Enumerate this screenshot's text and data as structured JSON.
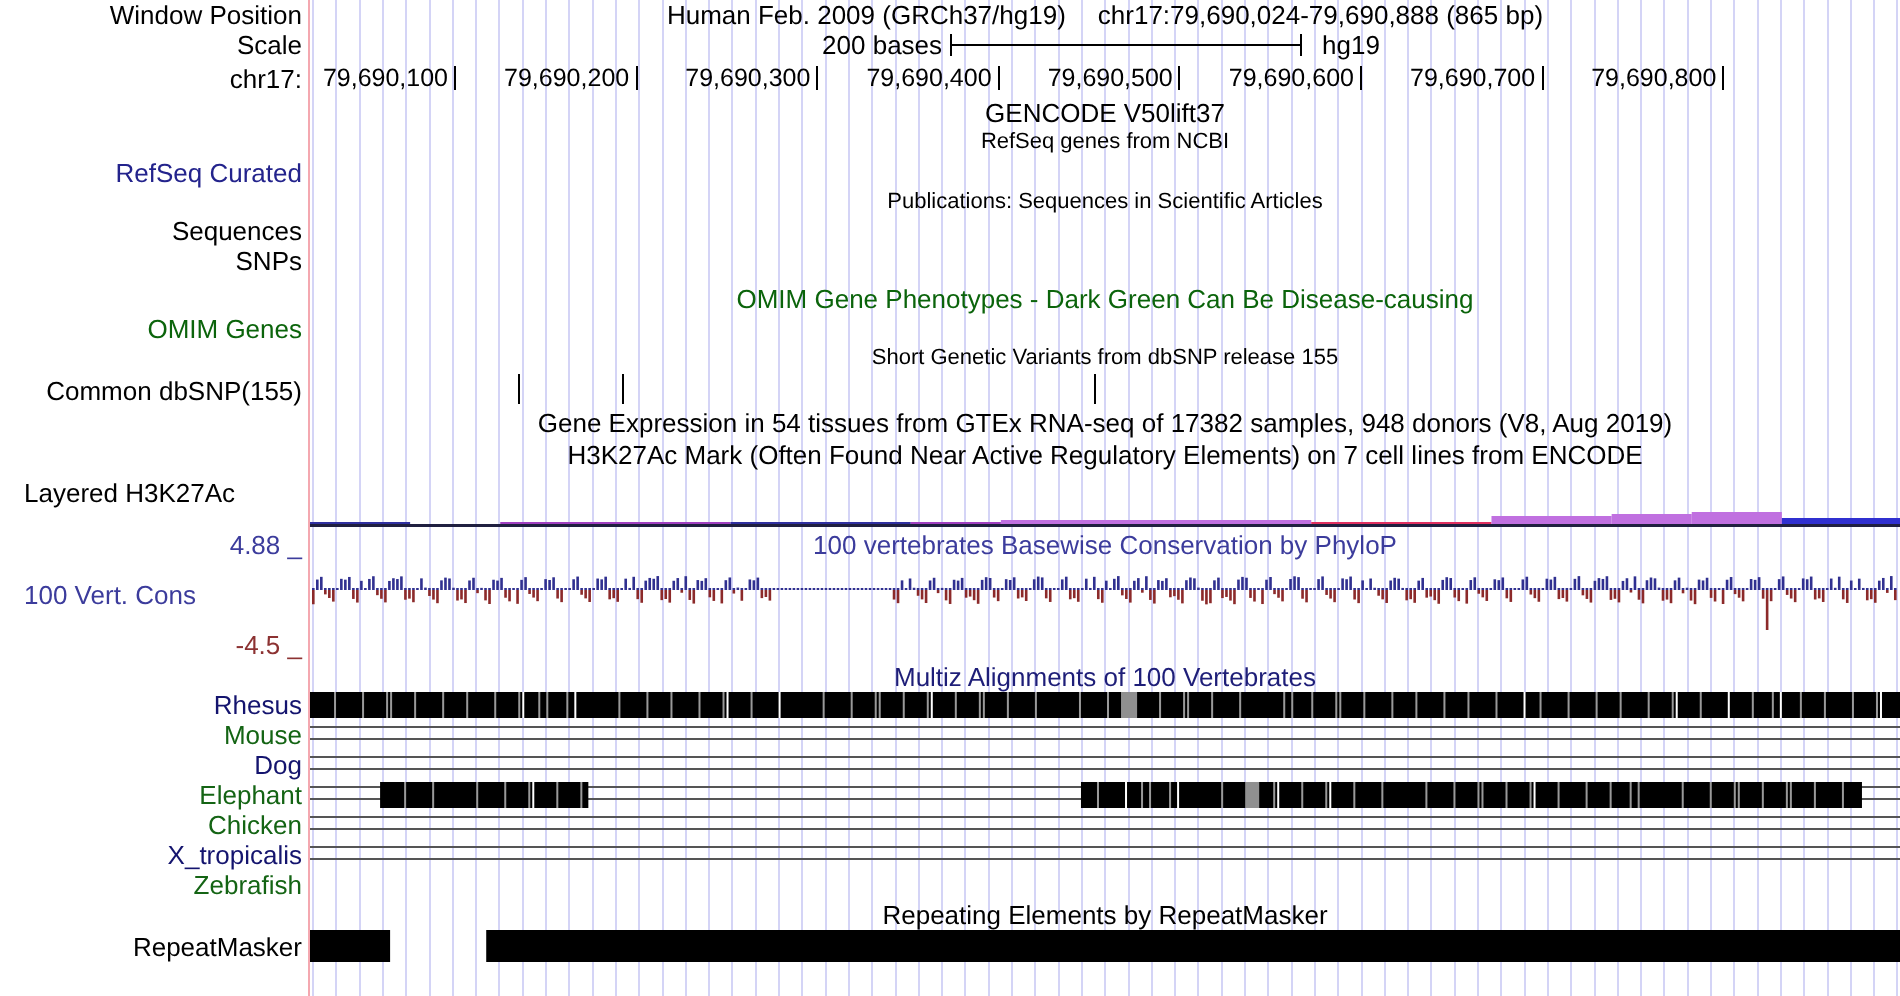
{
  "window_position": {
    "label": "Window Position",
    "assembly": "Human Feb. 2009 (GRCh37/hg19)",
    "region": "chr17:79,690,024-79,690,888 (865 bp)"
  },
  "scale": {
    "label": "Scale",
    "length": "200 bases",
    "assembly": "hg19"
  },
  "ruler": {
    "label": "chr17:",
    "ticks": [
      "79,690,100",
      "79,690,200",
      "79,690,300",
      "79,690,400",
      "79,690,500",
      "79,690,600",
      "79,690,700",
      "79,690,800"
    ]
  },
  "tracks": [
    {
      "kind": "title",
      "title": {
        "text": "GENCODE V50lift37",
        "color": "#000000"
      }
    },
    {
      "kind": "genes",
      "title": {
        "text": "RefSeq genes from NCBI",
        "color": "#000000"
      },
      "label": "RefSeq Curated",
      "color": "#23238c"
    },
    {
      "kind": "publications",
      "title": {
        "text": "Publications: Sequences in Scientific Articles",
        "color": "#000000"
      },
      "labels": [
        "Sequences",
        "SNPs"
      ]
    },
    {
      "kind": "omim",
      "title": {
        "text": "OMIM Gene Phenotypes - Dark Green Can Be Disease-causing",
        "color": "#0b640b"
      },
      "label": "OMIM Genes",
      "color": "#0b640b"
    },
    {
      "kind": "snp",
      "title": {
        "text": "Short Genetic Variants from dbSNP release 155",
        "color": "#000000"
      },
      "label": "Common dbSNP(155)",
      "color": "#000000"
    },
    {
      "kind": "title",
      "title": {
        "text": "Gene Expression in 54 tissues from GTEx RNA-seq of 17382 samples, 948 donors (V8, Aug 2019)",
        "color": "#000000"
      }
    },
    {
      "kind": "signal",
      "title": {
        "text": "H3K27Ac Mark (Often Found Near Active Regulatory Elements) on 7 cell lines from ENCODE",
        "color": "#000000"
      },
      "label": "Layered H3K27Ac",
      "color": "#000000"
    },
    {
      "kind": "conservation",
      "title": {
        "text": "100 vertebrates Basewise Conservation by PhyloP",
        "color": "#3c3c9c"
      },
      "upper": {
        "text": "4.88 _",
        "color": "#3c3c9c"
      },
      "label": "100 Vert. Cons",
      "color": "#3c3c9c",
      "lower": {
        "text": "-4.5 _",
        "color": "#8c3232"
      }
    },
    {
      "kind": "alignment",
      "title": {
        "text": "Multiz Alignments of 100 Vertebrates",
        "color": "#1e1e78"
      },
      "species": [
        {
          "name": "Rhesus",
          "color": "#14146e",
          "kind": "dense"
        },
        {
          "name": "Mouse",
          "color": "#146414",
          "kind": "lines"
        },
        {
          "name": "Dog",
          "color": "#14146e",
          "kind": "lines"
        },
        {
          "name": "Elephant",
          "color": "#146414",
          "kind": "partial"
        },
        {
          "name": "Chicken",
          "color": "#146414",
          "kind": "lines"
        },
        {
          "name": "X_tropicalis",
          "color": "#14146e",
          "kind": "lines"
        },
        {
          "name": "Zebrafish",
          "color": "#146414",
          "kind": "empty"
        }
      ]
    },
    {
      "kind": "repeats",
      "title": {
        "text": "Repeating Elements by RepeatMasker",
        "color": "#000000"
      },
      "label": "RepeatMasker",
      "color": "#000000"
    }
  ]
}
